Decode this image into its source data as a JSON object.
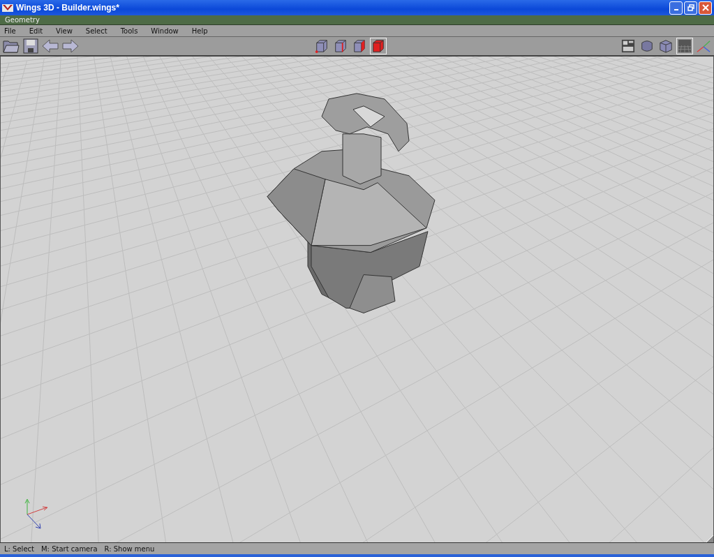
{
  "window": {
    "title": "Wings 3D - Builder.wings*"
  },
  "geometry_window": {
    "title": "Geometry"
  },
  "menu": [
    "File",
    "Edit",
    "View",
    "Select",
    "Tools",
    "Window",
    "Help"
  ],
  "file_tools": [
    {
      "kind": "open"
    },
    {
      "kind": "save"
    },
    {
      "kind": "undo"
    },
    {
      "kind": "redo"
    }
  ],
  "selection_modes": [
    {
      "kind": "vertex",
      "selected": false
    },
    {
      "kind": "edge",
      "selected": false
    },
    {
      "kind": "face",
      "selected": false
    },
    {
      "kind": "body",
      "selected": true
    }
  ],
  "view_tools": [
    {
      "kind": "workmode",
      "selected": false
    },
    {
      "kind": "smooth",
      "selected": false
    },
    {
      "kind": "flat",
      "selected": false
    },
    {
      "kind": "ground",
      "selected": true
    },
    {
      "kind": "axes",
      "selected": false
    }
  ],
  "status_bar": [
    "L: Select",
    "M: Start camera",
    "R: Show menu"
  ]
}
